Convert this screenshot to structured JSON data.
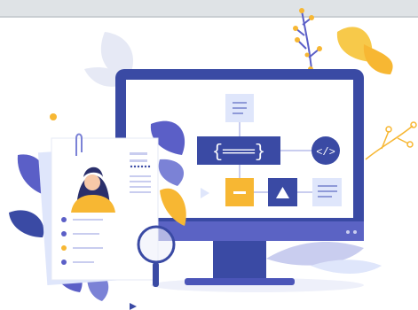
{
  "illustration": {
    "subject": "developer-profile-with-code-monitor",
    "icons": [
      "code-brackets-icon",
      "html-tag-icon",
      "text-lines-icon",
      "minus-icon",
      "triangle-icon",
      "magnifier-icon",
      "profile-photo-icon"
    ]
  },
  "colors": {
    "accent_blue": "#3a4aa4",
    "accent_yellow": "#f7b733",
    "light_lavender": "#c9cdef",
    "screen_white": "#ffffff",
    "card_blue": "#dfe6fb",
    "leaf_purple": "#5b5fc7",
    "topbar_gray": "#dfe3e6"
  }
}
